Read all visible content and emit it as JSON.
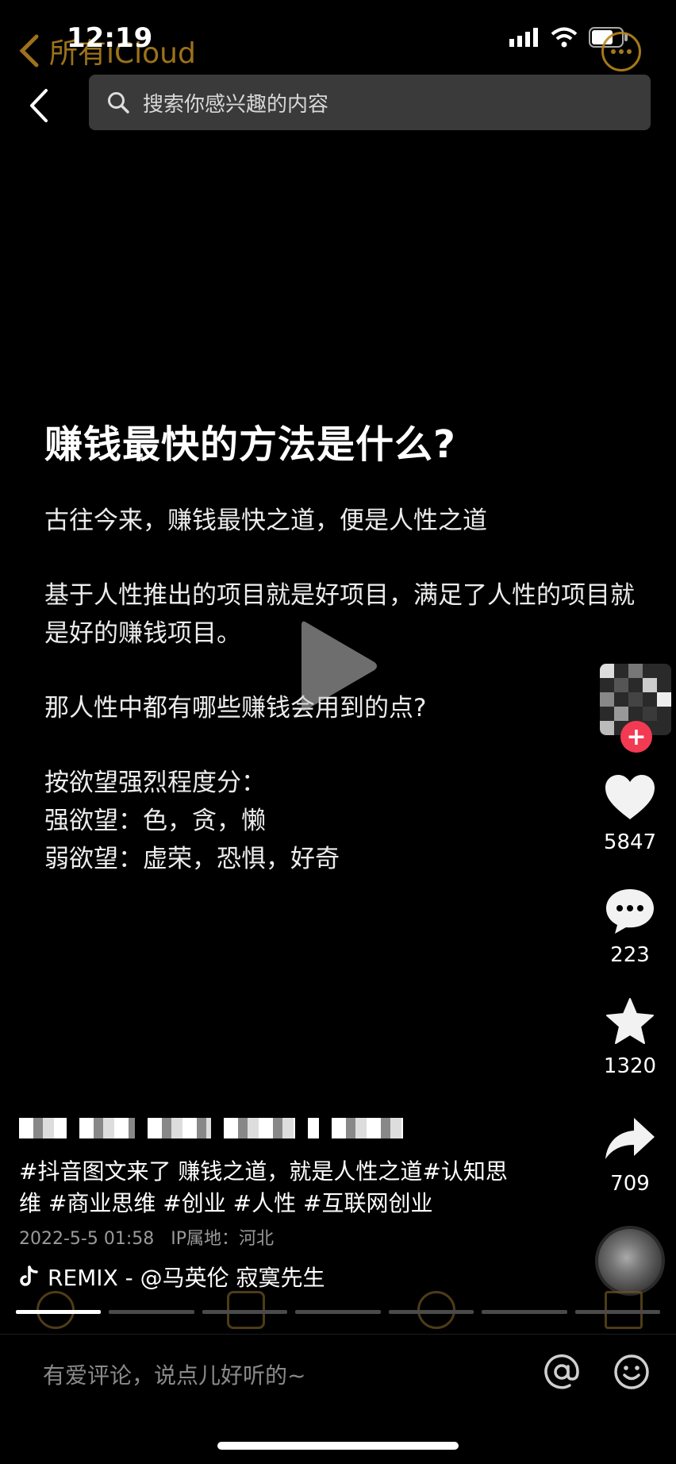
{
  "status_bar": {
    "time": "12:19"
  },
  "icloud_overlay": {
    "back_label": "所有iCloud"
  },
  "search": {
    "placeholder": "搜索你感兴趣的内容"
  },
  "post": {
    "title": "赚钱最快的方法是什么?",
    "paragraphs": [
      "古往今来，赚钱最快之道，便是人性之道",
      "基于人性推出的项目就是好项目，满足了人性的项目就是好的赚钱项目。",
      "那人性中都有哪些赚钱会用到的点?"
    ],
    "list_heading": "按欲望强烈程度分：",
    "list_items": [
      "强欲望：色，贪，懒",
      "弱欲望：虚荣，恐惧，好奇"
    ]
  },
  "rail": {
    "likes": "5847",
    "comments": "223",
    "favorites": "1320",
    "shares": "709",
    "follow_symbol": "+"
  },
  "info": {
    "caption": "#抖音图文来了 赚钱之道，就是人性之道#认知思维 #商业思维 #创业 #人性 #互联网创业",
    "date": "2022-5-5 01:58",
    "ip_location": "IP属地：河北",
    "music": "REMIX - @马英伦   寂寞先生"
  },
  "progress": {
    "total": 7,
    "current": 1
  },
  "comment_bar": {
    "placeholder": "有爱评论，说点儿好听的~"
  },
  "icons": {
    "back": "chevron-left-icon",
    "search": "magnifier-icon",
    "play": "play-icon",
    "like": "heart-icon",
    "comment": "speech-bubble-icon",
    "favorite": "star-icon",
    "share": "share-arrow-icon",
    "music": "tiktok-note-icon",
    "at": "at-sign-icon",
    "emoji": "smiley-icon"
  },
  "colors": {
    "background": "#000000",
    "icloud_accent": "#b8861f",
    "follow_red": "#f23b53"
  }
}
